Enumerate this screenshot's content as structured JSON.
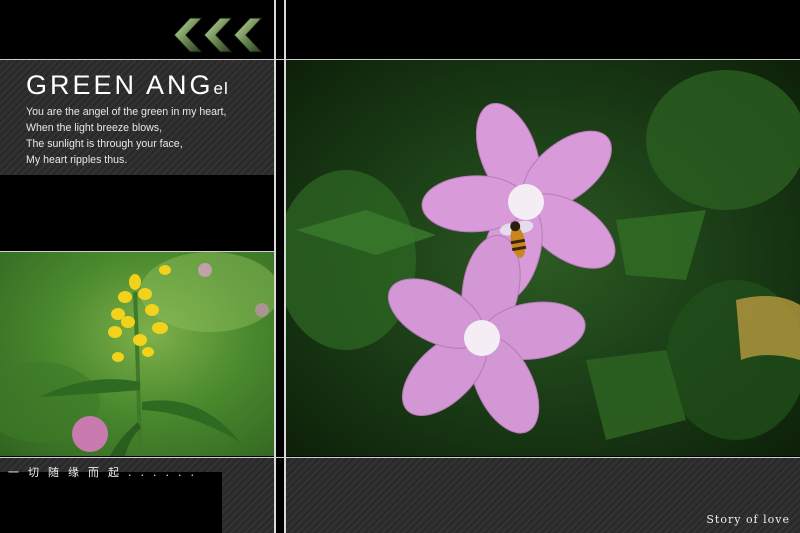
{
  "header": {
    "title_main": "GREEN ANG",
    "title_small": "el"
  },
  "poem": {
    "lines": [
      "You are the angel of the green in my heart,",
      "When the light breeze blows,",
      "The sunlight is through your face,",
      "My heart ripples thus."
    ]
  },
  "caption": "一切随缘而起......",
  "footer": {
    "tagline": "Story of love"
  },
  "icons": {
    "chevrons": "triple-left-chevron-icon",
    "chevron_color": "#6f8f55"
  },
  "photos": {
    "left": "yellow-flower-photo",
    "main": "pink-mallow-flowers-with-bee-photo"
  }
}
